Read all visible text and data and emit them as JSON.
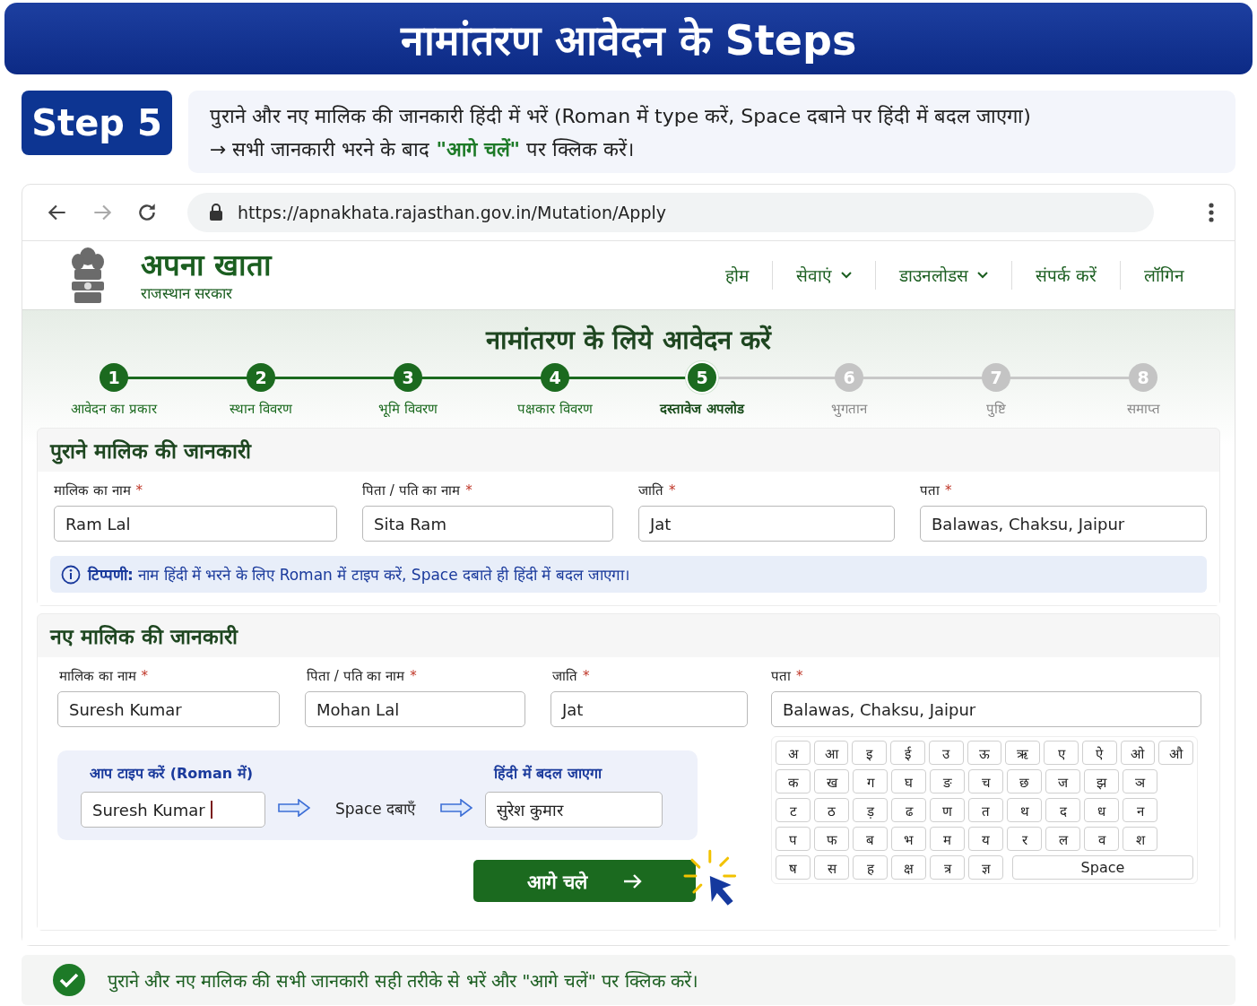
{
  "banner": {
    "title": "नामांतरण आवेदन के Steps"
  },
  "step": {
    "label": "Step 5",
    "lines": [
      "पुराने और नए मालिक की जानकारी हिंदी में भरें (Roman में type करें, Space दबाने पर हिंदी में बदल जाएगा)",
      "→ सभी जानकारी भरने के बाद **\"आगे चलें\"** पर क्लिक करें।"
    ]
  },
  "browser": {
    "url": "https://apnakhata.rajasthan.gov.in/Mutation/Apply"
  },
  "site": {
    "title": "अपना खाता",
    "subtitle": "राजस्थान सरकार",
    "nav": [
      {
        "label": "होम",
        "dropdown": false
      },
      {
        "label": "सेवाएं",
        "dropdown": true
      },
      {
        "label": "डाउनलोडस",
        "dropdown": true
      },
      {
        "label": "संपर्क करें",
        "dropdown": false
      },
      {
        "label": "लॉगिन",
        "dropdown": false
      }
    ]
  },
  "page_title": "नामांतरण के लिये आवेदन करें",
  "steps": [
    {
      "number": "1",
      "label": "आवेदन का प्रकार",
      "completed": true,
      "current": false
    },
    {
      "number": "2",
      "label": "स्थान विवरण",
      "completed": true,
      "current": false
    },
    {
      "number": "3",
      "label": "भूमि विवरण",
      "completed": true,
      "current": false
    },
    {
      "number": "4",
      "label": "पक्षकार विवरण",
      "completed": true,
      "current": false
    },
    {
      "number": "5",
      "label": "दस्तावेज अपलोड",
      "completed": true,
      "current": true
    },
    {
      "number": "6",
      "label": "भुगतान",
      "completed": false,
      "current": false
    },
    {
      "number": "7",
      "label": "पुष्टि",
      "completed": false,
      "current": false
    },
    {
      "number": "8",
      "label": "समाप्त",
      "completed": false,
      "current": false
    }
  ],
  "old_owner": {
    "heading": "पुराने मालिक की जानकारी",
    "fields": [
      {
        "label": "मालिक का नाम",
        "required_mark": "*",
        "value": "Ram Lal"
      },
      {
        "label": "पिता / पति का नाम",
        "required_mark": "*",
        "value": "Sita Ram"
      },
      {
        "label": "जाति",
        "required_mark": "*",
        "value": "Jat"
      },
      {
        "label": "पता",
        "required_mark": "*",
        "value": "Balawas, Chaksu, Jaipur"
      }
    ],
    "note": "**टिप्पणी:** नाम हिंदी में भरने के लिए Roman में टाइप करें, Space दबाते ही हिंदी में बदल जाएगा।"
  },
  "new_owner": {
    "heading": "नए मालिक की जानकारी",
    "fields": [
      {
        "label": "मालिक का नाम",
        "required_mark": "*",
        "value": "Suresh Kumar"
      },
      {
        "label": "पिता / पति का नाम",
        "required_mark": "*",
        "value": "Mohan Lal"
      },
      {
        "label": "जाति",
        "required_mark": "*",
        "value": "Jat"
      },
      {
        "label": "पता",
        "required_mark": "*",
        "value": "Balawas, Chaksu, Jaipur"
      }
    ],
    "demo": {
      "input_label": "आप टाइप करें (Roman में)",
      "input_value": "Suresh Kumar",
      "step_text": "Space दबाएँ",
      "output_label": "हिंदी में बदल जाएगा",
      "output_value": "सुरेश कुमार"
    },
    "keyboard": {
      "rows": [
        [
          "अ",
          "आ",
          "इ",
          "ई",
          "उ",
          "ऊ",
          "ऋ",
          "ए",
          "ऐ",
          "ओ",
          "औ"
        ],
        [
          "क",
          "ख",
          "ग",
          "घ",
          "ङ",
          "च",
          "छ",
          "ज",
          "झ",
          "ञ"
        ],
        [
          "ट",
          "ठ",
          "ड़",
          "ढ",
          "ण",
          "त",
          "थ",
          "द",
          "ध",
          "न"
        ],
        [
          "प",
          "फ",
          "ब",
          "भ",
          "म",
          "य",
          "र",
          "ल",
          "व",
          "श"
        ],
        [
          "ष",
          "स",
          "ह",
          "क्ष",
          "त्र",
          "ज्ञ"
        ]
      ],
      "space": "Space"
    },
    "next_button": "आगे चले"
  },
  "footer_note": "पुराने और नए मालिक की सभी जानकारी सही तरीके से भरें और \"आगे चलें\" पर क्लिक करें।"
}
